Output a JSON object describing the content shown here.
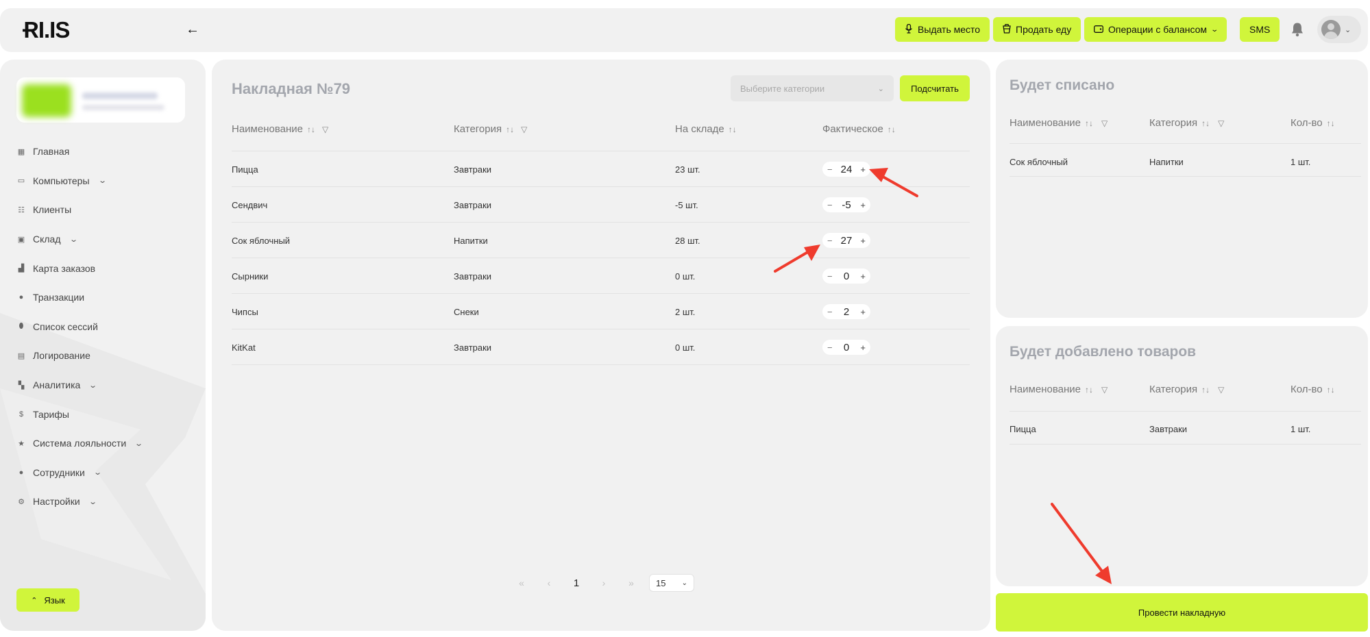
{
  "topbar": {
    "logo": "ɌI.IS",
    "back_icon": "←",
    "buttons": [
      {
        "label": "Выдать место",
        "icon": "mic-icon"
      },
      {
        "label": "Продать еду",
        "icon": "cup-icon"
      },
      {
        "label": "Операции с балансом",
        "icon": "wallet-icon"
      },
      {
        "label": "SMS"
      }
    ]
  },
  "sidebar": {
    "items": [
      {
        "label": "Главная",
        "icon": "grid-icon",
        "expandable": false
      },
      {
        "label": "Компьютеры",
        "icon": "monitor-icon",
        "expandable": true
      },
      {
        "label": "Клиенты",
        "icon": "users-icon",
        "expandable": false
      },
      {
        "label": "Склад",
        "icon": "box-icon",
        "expandable": true
      },
      {
        "label": "Карта заказов",
        "icon": "map-icon",
        "expandable": false
      },
      {
        "label": "Транзакции",
        "icon": "coin-icon",
        "expandable": false
      },
      {
        "label": "Список сессий",
        "icon": "mouse-icon",
        "expandable": false
      },
      {
        "label": "Логирование",
        "icon": "file-icon",
        "expandable": false
      },
      {
        "label": "Аналитика",
        "icon": "dashboard-icon",
        "expandable": true
      },
      {
        "label": "Тарифы",
        "icon": "dollar-icon",
        "expandable": false
      },
      {
        "label": "Система лояльности",
        "icon": "star-icon",
        "expandable": true
      },
      {
        "label": "Сотрудники",
        "icon": "person-icon",
        "expandable": true
      },
      {
        "label": "Настройки",
        "icon": "gear-icon",
        "expandable": true
      }
    ],
    "language_button": "Язык"
  },
  "invoice": {
    "title": "Накладная №79",
    "category_placeholder": "Выберите категории",
    "calculate_button": "Подсчитать",
    "columns": {
      "name": "Наименование",
      "category": "Категория",
      "stock": "На складе",
      "actual": "Фактическое"
    },
    "rows": [
      {
        "name": "Пицца",
        "category": "Завтраки",
        "stock": "23 шт.",
        "actual": "24"
      },
      {
        "name": "Сендвич",
        "category": "Завтраки",
        "stock": "-5 шт.",
        "actual": "-5"
      },
      {
        "name": "Сок яблочный",
        "category": "Напитки",
        "stock": "28 шт.",
        "actual": "27"
      },
      {
        "name": "Сырники",
        "category": "Завтраки",
        "stock": "0 шт.",
        "actual": "0"
      },
      {
        "name": "Чипсы",
        "category": "Снеки",
        "stock": "2 шт.",
        "actual": "2"
      },
      {
        "name": "KitKat",
        "category": "Завтраки",
        "stock": "0 шт.",
        "actual": "0"
      }
    ],
    "pagination": {
      "first": "«",
      "prev": "‹",
      "current": "1",
      "next": "›",
      "last": "»",
      "page_size": "15"
    }
  },
  "written_off": {
    "title": "Будет списано",
    "columns": {
      "name": "Наименование",
      "category": "Категория",
      "qty": "Кол-во"
    },
    "rows": [
      {
        "name": "Сок яблочный",
        "category": "Напитки",
        "qty": "1 шт."
      }
    ]
  },
  "added": {
    "title": "Будет добавлено товаров",
    "columns": {
      "name": "Наименование",
      "category": "Категория",
      "qty": "Кол-во"
    },
    "rows": [
      {
        "name": "Пицца",
        "category": "Завтраки",
        "qty": "1 шт."
      }
    ]
  },
  "post_button": "Провести накладную",
  "colors": {
    "accent": "#d0f53b",
    "panel": "#f1f1f1",
    "annotation_arrow": "#ef3b2d"
  }
}
